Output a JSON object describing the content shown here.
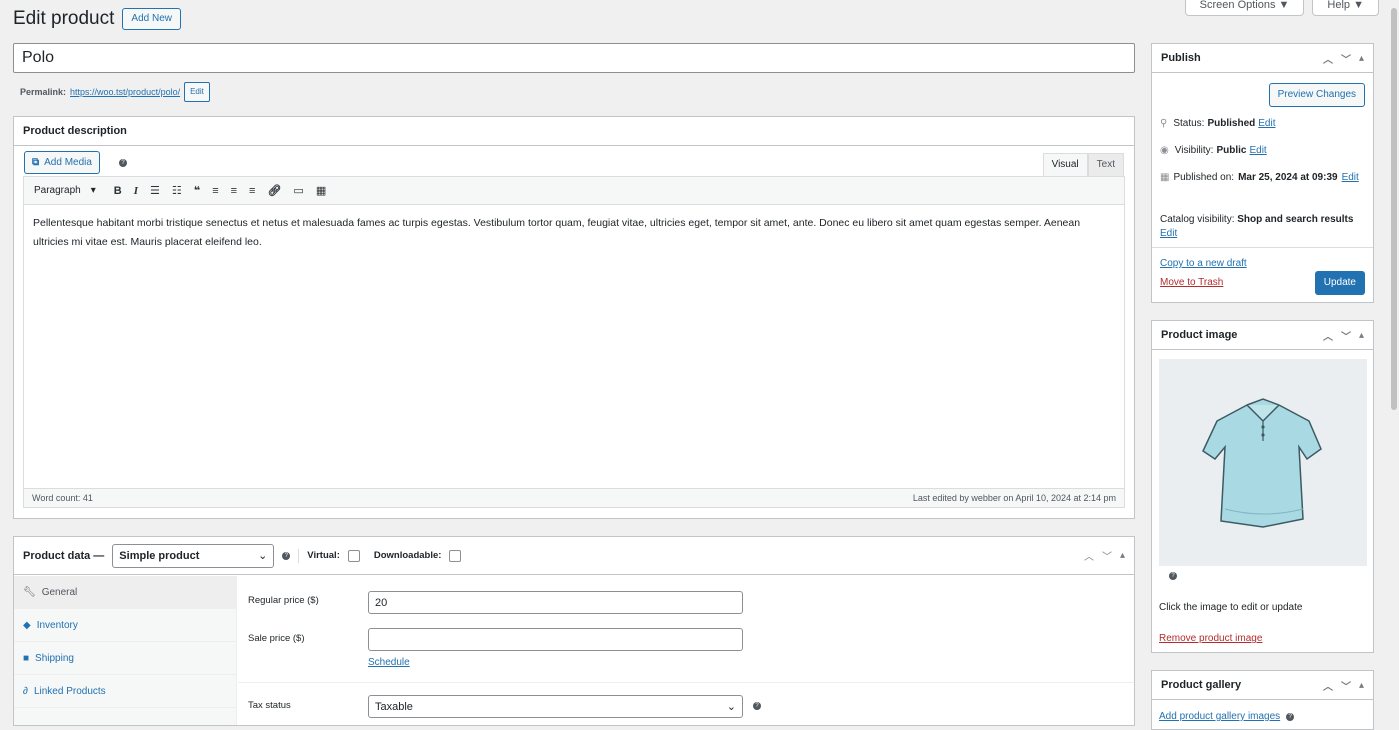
{
  "header": {
    "page_title": "Edit product",
    "add_new_label": "Add New",
    "screen_options_label": "Screen Options ▼",
    "help_label": "Help ▼"
  },
  "post": {
    "title_value": "Polo",
    "permalink_label": "Permalink:",
    "permalink_url": "https://woo.tst/product/polo/",
    "permalink_edit_label": "Edit"
  },
  "description": {
    "box_title": "Product description",
    "add_media_label": "Add Media",
    "tab_visual": "Visual",
    "tab_text": "Text",
    "format_select": "Paragraph",
    "content": "Pellentesque habitant morbi tristique senectus et netus et malesuada fames ac turpis egestas. Vestibulum tortor quam, feugiat vitae, ultricies eget, tempor sit amet, ante. Donec eu libero sit amet quam egestas semper. Aenean ultricies mi vitae est. Mauris placerat eleifend leo.",
    "word_count": "Word count: 41",
    "last_edited": "Last edited by webber on April 10, 2024 at 2:14 pm"
  },
  "product_data": {
    "title": "Product data —",
    "type_select": "Simple product",
    "virtual_label": "Virtual:",
    "downloadable_label": "Downloadable:",
    "tabs": [
      {
        "label": "General",
        "icon": "wrench-icon"
      },
      {
        "label": "Inventory",
        "icon": "tag-icon"
      },
      {
        "label": "Shipping",
        "icon": "truck-icon"
      },
      {
        "label": "Linked Products",
        "icon": "link-icon"
      }
    ],
    "regular_price_label": "Regular price ($)",
    "regular_price_value": "20",
    "sale_price_label": "Sale price ($)",
    "sale_price_value": "",
    "schedule_label": "Schedule",
    "tax_status_label": "Tax status",
    "tax_status_value": "Taxable"
  },
  "publish": {
    "title": "Publish",
    "preview_label": "Preview Changes",
    "status_label": "Status:",
    "status_value": "Published",
    "visibility_label": "Visibility:",
    "visibility_value": "Public",
    "published_on_label": "Published on:",
    "published_on_value": "Mar 25, 2024 at 09:39",
    "catalog_label": "Catalog visibility:",
    "catalog_value": "Shop and search results",
    "edit_label": "Edit",
    "copy_draft_label": "Copy to a new draft",
    "trash_label": "Move to Trash",
    "update_label": "Update"
  },
  "product_image": {
    "title": "Product image",
    "hint": "Click the image to edit or update",
    "remove_label": "Remove product image"
  },
  "gallery": {
    "title": "Product gallery",
    "add_label": "Add product gallery images"
  },
  "colors": {
    "accent": "#2271b1",
    "danger": "#b32d2e",
    "shirt": "#a9d9e2"
  }
}
